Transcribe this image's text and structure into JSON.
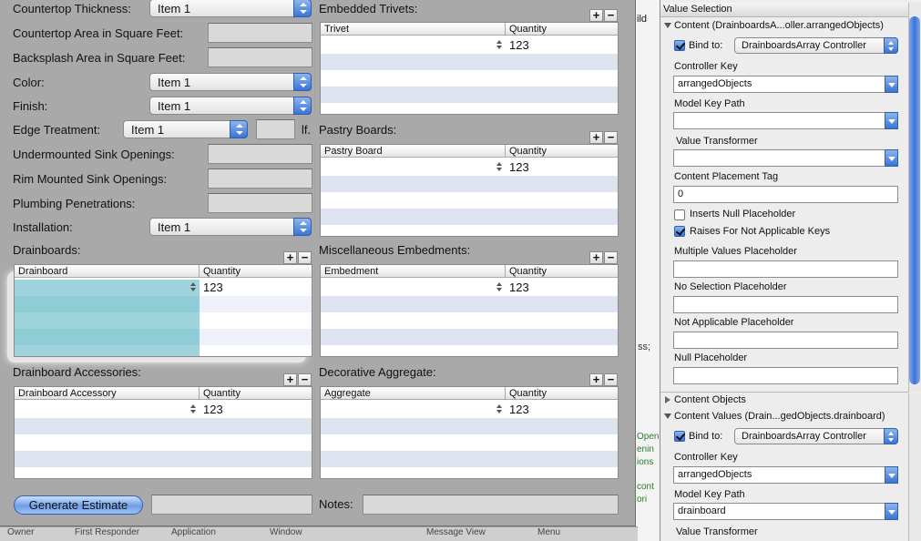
{
  "form": {
    "countertop_thickness_label": "Countertop Thickness:",
    "countertop_thickness_value": "Item 1",
    "countertop_area_label": "Countertop Area in Square Feet:",
    "backsplash_area_label": "Backsplash Area in Square Feet:",
    "color_label": "Color:",
    "color_value": "Item 1",
    "finish_label": "Finish:",
    "finish_value": "Item 1",
    "edge_treatment_label": "Edge Treatment:",
    "edge_treatment_value": "Item 1",
    "edge_unit": "lf.",
    "undermounted_label": "Undermounted Sink Openings:",
    "rim_mounted_label": "Rim Mounted Sink Openings:",
    "plumbing_label": "Plumbing Penetrations:",
    "installation_label": "Installation:",
    "installation_value": "Item 1",
    "generate_button": "Generate Estimate",
    "notes_label": "Notes:"
  },
  "tables": {
    "trivets": {
      "section": "Embedded Trivets:",
      "col1": "Trivet",
      "col2": "Quantity",
      "qty": "123"
    },
    "pastry": {
      "section": "Pastry Boards:",
      "col1": "Pastry Board",
      "col2": "Quantity",
      "qty": "123"
    },
    "drainboards": {
      "section": "Drainboards:",
      "col1": "Drainboard",
      "col2": "Quantity",
      "qty": "123"
    },
    "misc": {
      "section": "Miscellaneous Embedments:",
      "col1": "Embedment",
      "col2": "Quantity",
      "qty": "123"
    },
    "accessories": {
      "section": "Drainboard Accessories:",
      "col1": "Drainboard Accessory",
      "col2": "Quantity",
      "qty": "123"
    },
    "aggregate": {
      "section": "Decorative Aggregate:",
      "col1": "Aggregate",
      "col2": "Quantity",
      "qty": "123"
    }
  },
  "inspector": {
    "title": "Value Selection",
    "content_header": "Content (DrainboardsA...oller.arrangedObjects)",
    "bind_to_label": "Bind to:",
    "bind_to_value": "DrainboardsArray Controller",
    "controller_key_label": "Controller Key",
    "controller_key_value": "arrangedObjects",
    "model_key_path_label": "Model Key Path",
    "model_key_path_value": "",
    "value_transformer_label": "Value Transformer",
    "content_placement_tag_label": "Content Placement Tag",
    "content_placement_tag_value": "0",
    "inserts_null_label": "Inserts Null Placeholder",
    "raises_label": "Raises For Not Applicable Keys",
    "multiple_values_label": "Multiple Values Placeholder",
    "no_selection_label": "No Selection Placeholder",
    "not_applicable_label": "Not Applicable Placeholder",
    "null_placeholder_label": "Null Placeholder",
    "content_objects_header": "Content Objects",
    "content_values_header": "Content Values (Drain...gedObjects.drainboard)",
    "bind_to_label2": "Bind to:",
    "bind_to_value2": "DrainboardsArray Controller",
    "controller_key_label2": "Controller Key",
    "controller_key_value2": "arrangedObjects",
    "model_key_path_label2": "Model Key Path",
    "model_key_path_value2": "drainboard",
    "value_transformer_label2": "Value Transformer"
  },
  "background_window": {
    "tab_fragment": "ild",
    "code_fragments": [
      "ss;",
      "Open",
      "enin",
      "ions",
      "cont",
      "ori"
    ],
    "bottom_tabs": [
      "Owner",
      "First Responder",
      "Application",
      "Window",
      "Message View",
      "Menu"
    ]
  }
}
